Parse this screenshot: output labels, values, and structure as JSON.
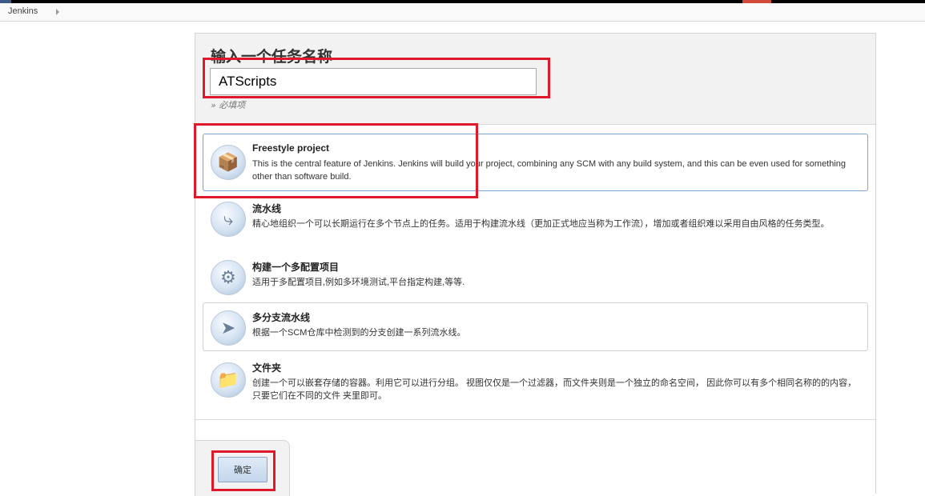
{
  "breadcrumb": {
    "root_label": "Jenkins"
  },
  "form": {
    "title": "输入一个任务名称",
    "job_name_value": "ATScripts",
    "required_hint": "» 必填项"
  },
  "job_types": [
    {
      "title": "Freestyle project",
      "description": "This is the central feature of Jenkins. Jenkins will build your project, combining any SCM with any build system, and this can be even used for something other than software build.",
      "icon": "freestyle-box-icon"
    },
    {
      "title": "流水线",
      "description": "精心地组织一个可以长期运行在多个节点上的任务。适用于构建流水线（更加正式地应当称为工作流），增加或者组织难以采用自由风格的任务类型。",
      "icon": "pipeline-icon"
    },
    {
      "title": "构建一个多配置项目",
      "description": "适用于多配置项目,例如多环境测试,平台指定构建,等等.",
      "icon": "multi-config-icon"
    },
    {
      "title": "多分支流水线",
      "description": "根据一个SCM仓库中检测到的分支创建一系列流水线。",
      "icon": "multibranch-icon"
    },
    {
      "title": "文件夹",
      "description": "创建一个可以嵌套存储的容器。利用它可以进行分组。 视图仅仅是一个过滤器，而文件夹则是一个独立的命名空间， 因此你可以有多个相同名称的的内容，只要它们在不同的文件 夹里即可。",
      "icon": "folder-icon"
    }
  ],
  "actions": {
    "ok_label": "确定"
  },
  "colors": {
    "highlight_box": "#e0192a",
    "selected_border": "#7aa6d6"
  }
}
